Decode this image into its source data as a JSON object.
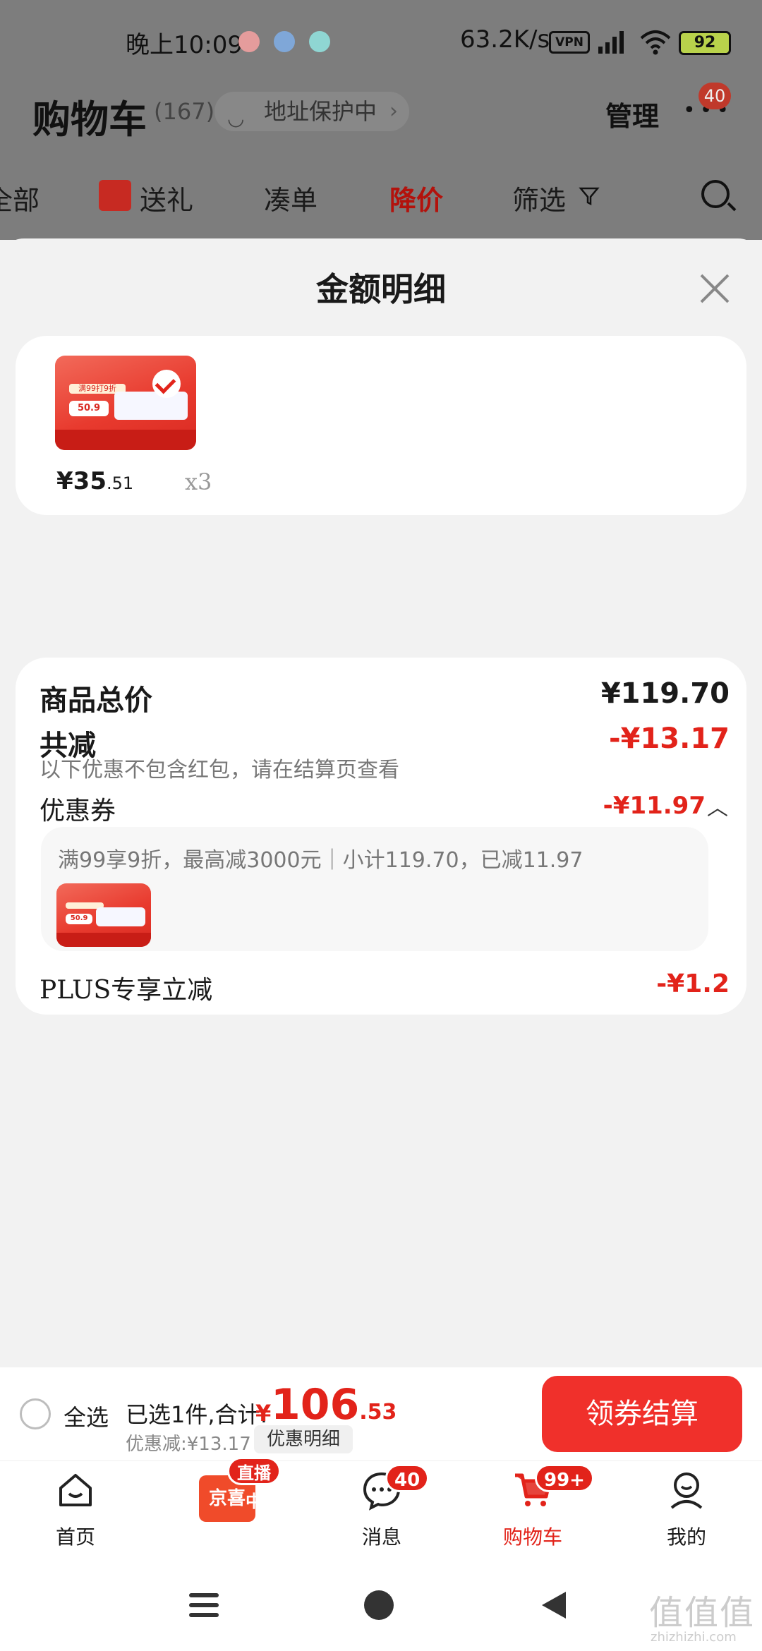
{
  "status_bar": {
    "time": "晚上10:09",
    "net_speed": "63.2K/s",
    "vpn_label": "VPN",
    "battery": "92"
  },
  "header": {
    "title": "购物车",
    "count": "(167)",
    "address_protect": "地址保护中",
    "manage": "管理",
    "badge": "40",
    "tabs": [
      "全部",
      "送礼",
      "凑单",
      "降价",
      "筛选"
    ],
    "active_tab": "降价"
  },
  "sheet": {
    "title": "金额明细",
    "product": {
      "price_main": "¥35",
      "price_decimal": ".51",
      "quantity": "x3",
      "thumb_promo": "满99打9折",
      "thumb_price": "50.9"
    },
    "summary": {
      "total_label": "商品总价",
      "total_value": "¥119.70",
      "reduce_label": "共减",
      "reduce_value": "-¥13.17",
      "reduce_note": "以下优惠不包含红包，请在结算页查看",
      "coupon_label": "优惠券",
      "coupon_value": "-¥11.97",
      "coupon_detail": "满99享9折，最高减3000元｜小计119.70，已减11.97",
      "plus_label": "PLUS专享立减",
      "plus_value": "-¥1.2"
    }
  },
  "bottom_bar": {
    "select_all": "全选",
    "selected_text": "已选1件,合计:",
    "total_symbol": "¥",
    "total_main": "106",
    "total_decimal": ".53",
    "discount_text": "优惠减:¥13.17",
    "detail_button": "优惠明细",
    "checkout_button": "领券结算"
  },
  "tab_bar": {
    "items": [
      {
        "label": "首页"
      },
      {
        "label": "京喜",
        "badge": "直播中"
      },
      {
        "label": "消息",
        "badge": "40"
      },
      {
        "label": "购物车",
        "badge": "99+"
      },
      {
        "label": "我的"
      }
    ]
  },
  "watermark": {
    "text": "值值值",
    "url": "zhizhizhi.com"
  },
  "colors": {
    "accent_red": "#e2231a",
    "overlay_gray": "#7d7d7d"
  }
}
